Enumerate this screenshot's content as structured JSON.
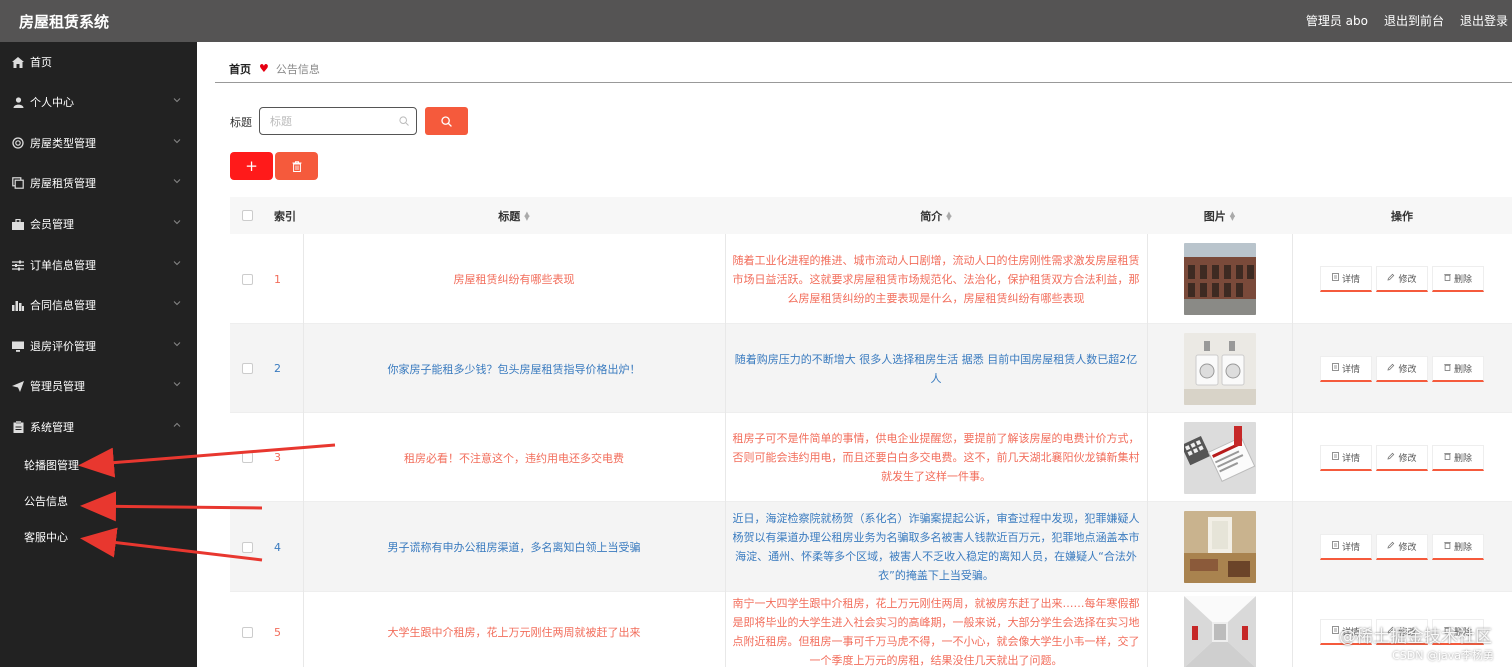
{
  "app": {
    "title": "房屋租赁系统"
  },
  "topbar": {
    "admin": "管理员 abo",
    "back_front": "退出到前台",
    "logout": "退出登录"
  },
  "sidebar": {
    "items": [
      {
        "label": "首页",
        "icon": "home-icon",
        "chevron": false
      },
      {
        "label": "个人中心",
        "icon": "user-icon",
        "chevron": true
      },
      {
        "label": "房屋类型管理",
        "icon": "globe-icon",
        "chevron": true
      },
      {
        "label": "房屋租赁管理",
        "icon": "copy-icon",
        "chevron": true
      },
      {
        "label": "会员管理",
        "icon": "briefcase-icon",
        "chevron": true
      },
      {
        "label": "订单信息管理",
        "icon": "sliders-icon",
        "chevron": true
      },
      {
        "label": "合同信息管理",
        "icon": "bar-chart-icon",
        "chevron": true
      },
      {
        "label": "退房评价管理",
        "icon": "desktop-icon",
        "chevron": true
      },
      {
        "label": "管理员管理",
        "icon": "send-icon",
        "chevron": true
      },
      {
        "label": "系统管理",
        "icon": "clipboard-icon",
        "chevron": true,
        "expanded": true
      }
    ],
    "sub_items": [
      "轮播图管理",
      "公告信息",
      "客服中心"
    ]
  },
  "breadcrumb": {
    "home": "首页",
    "current": "公告信息"
  },
  "search": {
    "label": "标题",
    "placeholder": "标题",
    "value": ""
  },
  "table": {
    "headers": {
      "index": "索引",
      "title": "标题",
      "desc": "简介",
      "image": "图片",
      "ops": "操作"
    },
    "actions": {
      "detail": "详情",
      "edit": "修改",
      "delete": "删除"
    },
    "rows": [
      {
        "index": "1",
        "color": "red",
        "title": "房屋租赁纠纷有哪些表现",
        "desc": "随着工业化进程的推进、城市流动人口剧增，流动人口的住房刚性需求激发房屋租赁市场日益活跃。这就要求房屋租赁市场规范化、法治化，保护租赁双方合法利益，那么房屋租赁纠纷的主要表现是什么，房屋租赁纠纷有哪些表现",
        "image": "building"
      },
      {
        "index": "2",
        "color": "blue",
        "title": "你家房子能租多少钱？包头房屋租赁指导价格出炉！",
        "desc": "随着购房压力的不断增大 很多人选择租房生活 据悉 目前中国房屋租赁人数已超2亿人",
        "image": "washer"
      },
      {
        "index": "3",
        "color": "red",
        "title": "租房必看！不注意这个，违约用电还多交电费",
        "desc": "租房子可不是件简单的事情，供电企业提醒您，要提前了解该房屋的电费计价方式，否则可能会违约用电，而且还要白白多交电费。这不，前几天湖北襄阳伙龙镇新集村就发生了这样一件事。",
        "image": "application"
      },
      {
        "index": "4",
        "color": "blue",
        "title": "男子谎称有申办公租房渠道，多名离知白领上当受骗",
        "desc": "近日，海淀检察院就杨贺（系化名）诈骗案提起公诉，审查过程中发现，犯罪嫌疑人杨贺以有渠道办理公租房业务为名骗取多名被害人钱款近百万元，犯罪地点涵盖本市海淀、通州、怀柔等多个区域，被害人不乏收入稳定的离知人员，在嫌疑人“合法外衣”的掩盖下上当受骗。",
        "image": "room"
      },
      {
        "index": "5",
        "color": "red",
        "title": "大学生跟中介租房，花上万元刚住两周就被赶了出来",
        "desc": "南宁一大四学生跟中介租房，花上万元刚住两周，就被房东赶了出来……每年寒假都是即将毕业的大学生进入社会实习的高峰期，一般来说，大部分学生会选择在实习地点附近租房。但租房一事可千万马虎不得，一不小心，就会像大学生小韦一样，交了一个季度上万元的房租，结果没住几天就出了问题。",
        "image": "corridor"
      }
    ]
  },
  "watermark": {
    "line1": "@稀土掘金技术社区",
    "line2": "CSDN @java李杨勇"
  },
  "colors": {
    "accent": "#f55a3c",
    "red_text": "#f26d5b",
    "blue_text": "#3a7bbf",
    "sidebar_bg": "#222222",
    "header_bg": "#555454"
  }
}
